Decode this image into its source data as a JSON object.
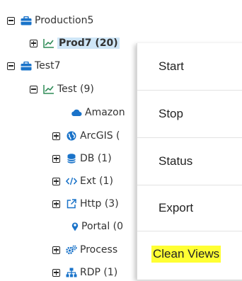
{
  "tree": {
    "production5": {
      "label": "Production5"
    },
    "prod7": {
      "label": "Prod7 (20)"
    },
    "test7": {
      "label": "Test7"
    },
    "test": {
      "label": "Test (9)"
    },
    "amazon": {
      "label": "Amazon"
    },
    "arcgis": {
      "label": "ArcGIS ("
    },
    "db": {
      "label": "DB (1)"
    },
    "ext": {
      "label": "Ext (1)"
    },
    "http": {
      "label": "Http (3)"
    },
    "portal": {
      "label": "Portal (0"
    },
    "process": {
      "label": "Process"
    },
    "rdp": {
      "label": "RDP (1)"
    }
  },
  "context_menu": {
    "items": [
      "Start",
      "Stop",
      "Status",
      "Export",
      "Clean Views"
    ]
  },
  "colors": {
    "tree_blue": "#1a73c9",
    "chart_green": "#2e8b57",
    "highlight": "#ffff33",
    "selection": "#cfe6f7"
  }
}
